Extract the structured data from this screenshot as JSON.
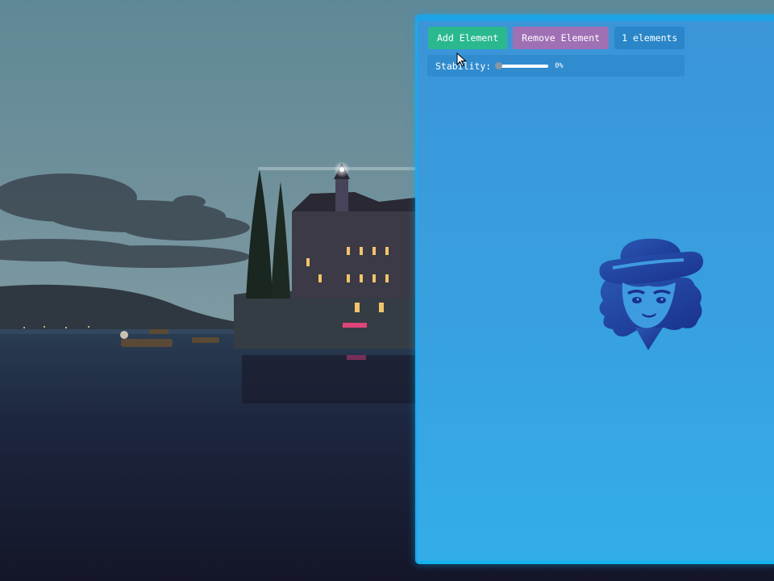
{
  "toolbar": {
    "add_label": "Add Element",
    "remove_label": "Remove Element",
    "count_label": "1 elements"
  },
  "stability": {
    "label": "Stability:",
    "value_text": "0%",
    "value": 0
  },
  "icons": {
    "mascot": "cowboy-hat-character-icon",
    "cursor": "mouse-pointer-icon"
  },
  "colors": {
    "window_bg": "#3b95d8",
    "add_button": "#2ab98f",
    "remove_button": "#a070b4",
    "count_badge": "#2a86c8",
    "mascot": "#1e3f9c"
  }
}
